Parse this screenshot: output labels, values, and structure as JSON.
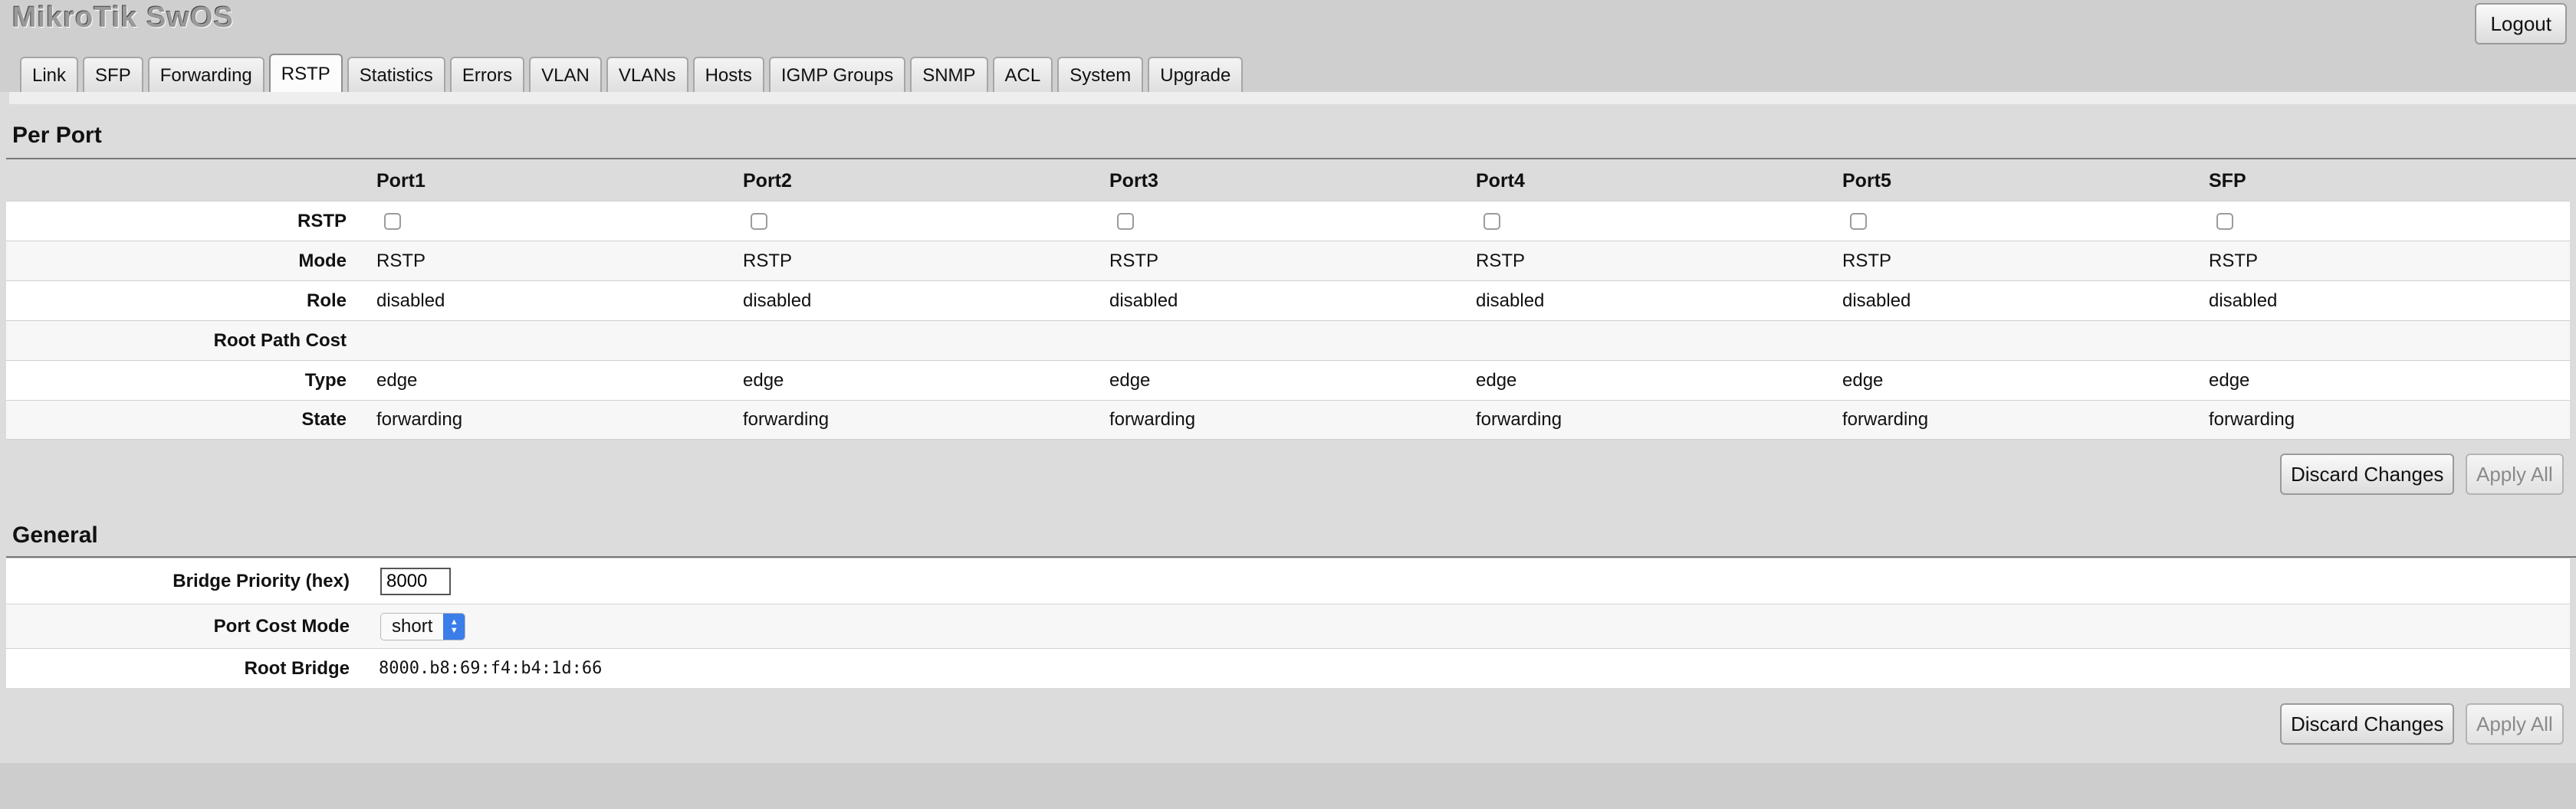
{
  "app": {
    "title": "MikroTik SwOS",
    "logout_label": "Logout"
  },
  "tabs": [
    {
      "label": "Link"
    },
    {
      "label": "SFP"
    },
    {
      "label": "Forwarding"
    },
    {
      "label": "RSTP"
    },
    {
      "label": "Statistics"
    },
    {
      "label": "Errors"
    },
    {
      "label": "VLAN"
    },
    {
      "label": "VLANs"
    },
    {
      "label": "Hosts"
    },
    {
      "label": "IGMP Groups"
    },
    {
      "label": "SNMP"
    },
    {
      "label": "ACL"
    },
    {
      "label": "System"
    },
    {
      "label": "Upgrade"
    }
  ],
  "active_tab": "RSTP",
  "per_port": {
    "title": "Per Port",
    "ports": [
      "Port1",
      "Port2",
      "Port3",
      "Port4",
      "Port5",
      "SFP"
    ],
    "rows": {
      "rstp": {
        "label": "RSTP",
        "values": [
          false,
          false,
          false,
          false,
          false,
          false
        ]
      },
      "mode": {
        "label": "Mode",
        "values": [
          "RSTP",
          "RSTP",
          "RSTP",
          "RSTP",
          "RSTP",
          "RSTP"
        ]
      },
      "role": {
        "label": "Role",
        "values": [
          "disabled",
          "disabled",
          "disabled",
          "disabled",
          "disabled",
          "disabled"
        ]
      },
      "root_path_cost": {
        "label": "Root Path Cost",
        "values": [
          "",
          "",
          "",
          "",
          "",
          ""
        ]
      },
      "type": {
        "label": "Type",
        "values": [
          "edge",
          "edge",
          "edge",
          "edge",
          "edge",
          "edge"
        ]
      },
      "state": {
        "label": "State",
        "values": [
          "forwarding",
          "forwarding",
          "forwarding",
          "forwarding",
          "forwarding",
          "forwarding"
        ]
      }
    },
    "discard_label": "Discard Changes",
    "apply_label": "Apply All"
  },
  "general": {
    "title": "General",
    "bridge_priority": {
      "label": "Bridge Priority (hex)",
      "value": "8000"
    },
    "port_cost_mode": {
      "label": "Port Cost Mode",
      "value": "short"
    },
    "root_bridge": {
      "label": "Root Bridge",
      "value": "8000.b8:69:f4:b4:1d:66"
    },
    "discard_label": "Discard Changes",
    "apply_label": "Apply All"
  }
}
